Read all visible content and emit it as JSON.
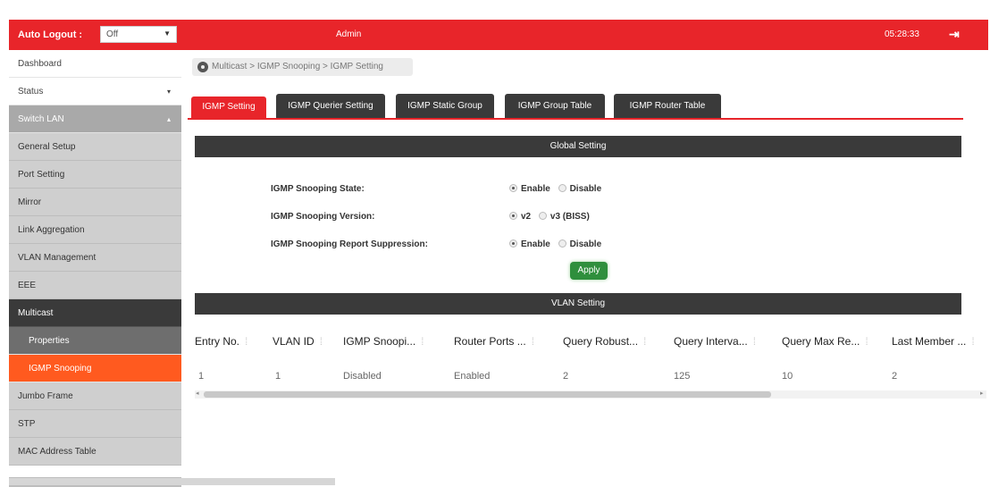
{
  "topbar": {
    "auto_logout_label": "Auto Logout :",
    "auto_logout_value": "Off",
    "user": "Admin",
    "clock": "05:28:33"
  },
  "sidebar": {
    "items": [
      {
        "label": "Dashboard"
      },
      {
        "label": "Status"
      },
      {
        "label": "Switch LAN"
      },
      {
        "label": "General Setup"
      },
      {
        "label": "Port Setting"
      },
      {
        "label": "Mirror"
      },
      {
        "label": "Link Aggregation"
      },
      {
        "label": "VLAN Management"
      },
      {
        "label": "EEE"
      },
      {
        "label": "Multicast"
      },
      {
        "label": "Properties"
      },
      {
        "label": "IGMP Snooping"
      },
      {
        "label": "Jumbo Frame"
      },
      {
        "label": "STP"
      },
      {
        "label": "MAC Address Table"
      }
    ]
  },
  "breadcrumb": "Multicast > IGMP Snooping > IGMP Setting",
  "tabs": [
    {
      "label": "IGMP Setting"
    },
    {
      "label": "IGMP Querier Setting"
    },
    {
      "label": "IGMP Static Group"
    },
    {
      "label": "IGMP Group Table"
    },
    {
      "label": "IGMP Router Table"
    }
  ],
  "global": {
    "title": "Global Setting",
    "rows": [
      {
        "label": "IGMP Snooping State:",
        "opt1": "Enable",
        "opt2": "Disable"
      },
      {
        "label": "IGMP Snooping Version:",
        "opt1": "v2",
        "opt2": "v3 (BISS)"
      },
      {
        "label": "IGMP Snooping Report Suppression:",
        "opt1": "Enable",
        "opt2": "Disable"
      }
    ],
    "apply": "Apply"
  },
  "vlan": {
    "title": "VLAN Setting",
    "columns": [
      "Entry No.",
      "VLAN ID",
      "IGMP Snoopi...",
      "Router Ports ...",
      "Query Robust...",
      "Query Interva...",
      "Query Max Re...",
      "Last Member ..."
    ],
    "rows": [
      [
        "1",
        "1",
        "Disabled",
        "Enabled",
        "2",
        "125",
        "10",
        "2"
      ]
    ]
  },
  "colors": {
    "brand_red": "#e8252a",
    "active_orange": "#ff5a1f",
    "dark_bar": "#3a3a3a",
    "apply_green": "#2f8f3d"
  }
}
